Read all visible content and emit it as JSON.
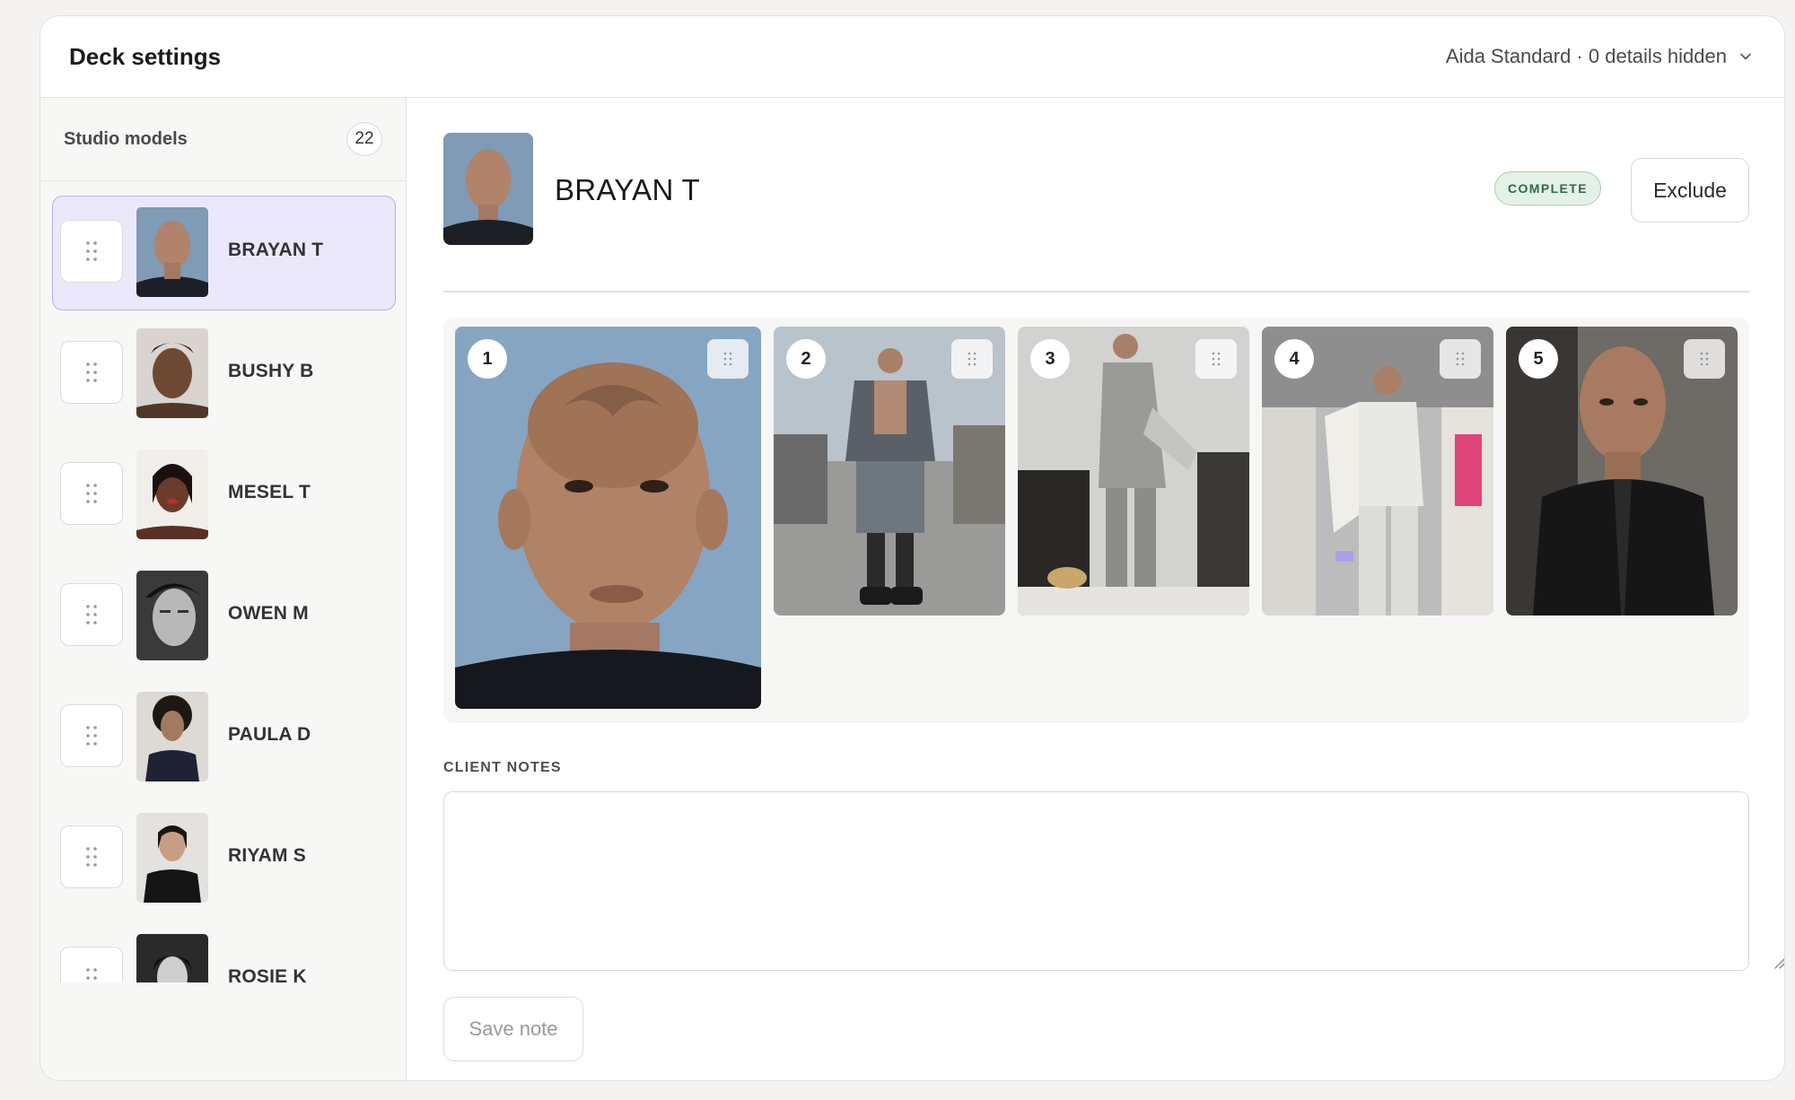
{
  "header": {
    "title": "Deck settings",
    "preset_label": "Aida Standard · 0 details hidden"
  },
  "sidebar": {
    "label": "Studio models",
    "count": "22",
    "models": [
      {
        "name": "BRAYAN T",
        "active": true
      },
      {
        "name": "BUSHY B",
        "active": false
      },
      {
        "name": "MESEL T",
        "active": false
      },
      {
        "name": "OWEN M",
        "active": false
      },
      {
        "name": "PAULA D",
        "active": false
      },
      {
        "name": "RIYAM S",
        "active": false
      },
      {
        "name": "ROSIE K",
        "active": false
      }
    ]
  },
  "main": {
    "model_name": "BRAYAN T",
    "status": "COMPLETE",
    "exclude_label": "Exclude",
    "photos": [
      {
        "index": "1"
      },
      {
        "index": "2"
      },
      {
        "index": "3"
      },
      {
        "index": "4"
      },
      {
        "index": "5"
      }
    ],
    "notes_label": "CLIENT NOTES",
    "notes_value": "",
    "save_label": "Save note"
  },
  "colors": {
    "accent_active_bg": "#ece8fb",
    "accent_active_border": "#b9b0e3",
    "status_green": "#2f6a42"
  }
}
